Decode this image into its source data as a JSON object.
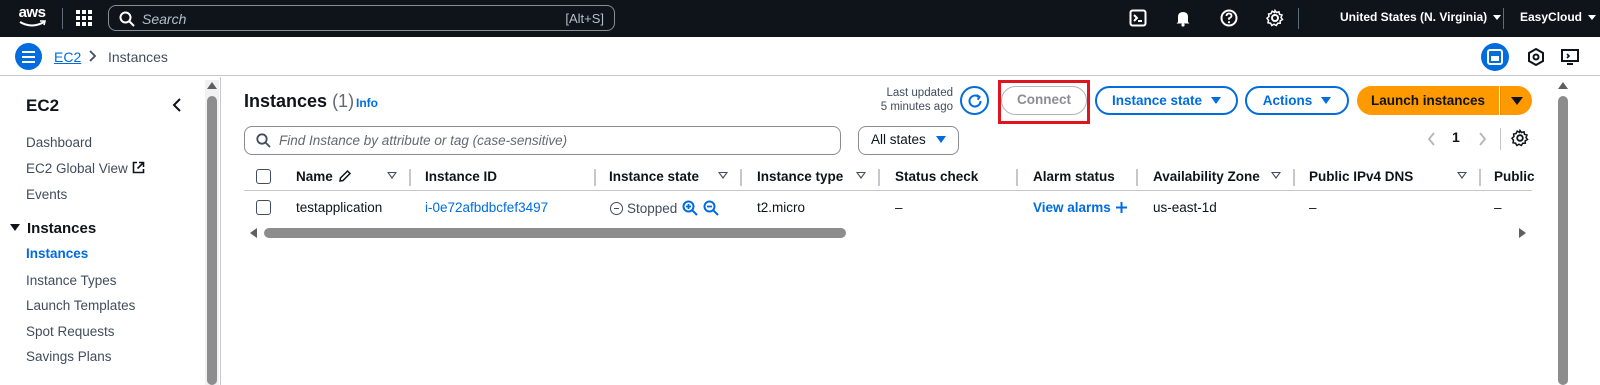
{
  "topnav": {
    "logo_text": "aws",
    "search_placeholder": "Search",
    "search_shortcut": "[Alt+S]",
    "region": "United States (N. Virginia)",
    "account": "EasyCloud"
  },
  "breadcrumb": {
    "service": "EC2",
    "current": "Instances"
  },
  "sidebar": {
    "title": "EC2",
    "top_items": [
      "Dashboard",
      "EC2 Global View",
      "Events"
    ],
    "section_label": "Instances",
    "section_items": [
      "Instances",
      "Instance Types",
      "Launch Templates",
      "Spot Requests",
      "Savings Plans"
    ],
    "active_item": "Instances"
  },
  "header": {
    "title": "Instances",
    "count": "(1)",
    "info": "Info",
    "last_updated_line1": "Last updated",
    "last_updated_line2": "5 minutes ago",
    "connect_label": "Connect",
    "instance_state_label": "Instance state",
    "actions_label": "Actions",
    "launch_label": "Launch instances"
  },
  "filter": {
    "placeholder": "Find Instance by attribute or tag (case-sensitive)",
    "states_value": "All states"
  },
  "pagination": {
    "current_page": "1"
  },
  "table": {
    "columns": [
      "Name",
      "Instance ID",
      "Instance state",
      "Instance type",
      "Status check",
      "Alarm status",
      "Availability Zone",
      "Public IPv4 DNS",
      "Public"
    ],
    "rows": [
      {
        "name": "testapplication",
        "instance_id": "i-0e72afbdbcfef3497",
        "state": "Stopped",
        "type": "t2.micro",
        "status_check": "–",
        "alarm": "View alarms",
        "az": "us-east-1d",
        "dns": "–",
        "public": "–"
      }
    ]
  },
  "colors": {
    "accent": "#006ce0",
    "launch": "#ff9900",
    "highlight": "#e0141e",
    "nav_bg": "#0f141a"
  }
}
